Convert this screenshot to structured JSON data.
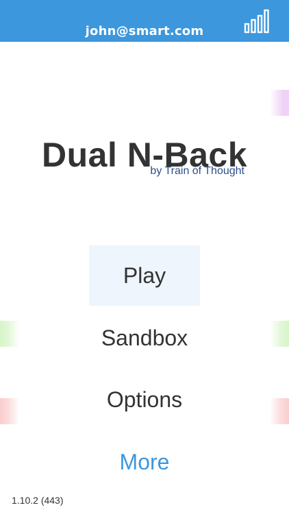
{
  "header": {
    "account_email": "john@smart.com",
    "stats_icon": "bar-chart-icon",
    "background_color": "#3c97dd"
  },
  "title": {
    "app_name": "Dual N-Back",
    "byline": "by Train of Thought"
  },
  "menu": {
    "items": [
      {
        "label": "Play",
        "highlighted": true
      },
      {
        "label": "Sandbox",
        "highlighted": false
      },
      {
        "label": "Options",
        "highlighted": false
      },
      {
        "label": "More",
        "highlighted": false,
        "color": "#3c97dd"
      }
    ]
  },
  "footer": {
    "version": "1.10.2 (443)"
  },
  "decor": {
    "accent_colors": [
      "#f0d2f6",
      "#d6f5c8",
      "#facdcd"
    ]
  }
}
